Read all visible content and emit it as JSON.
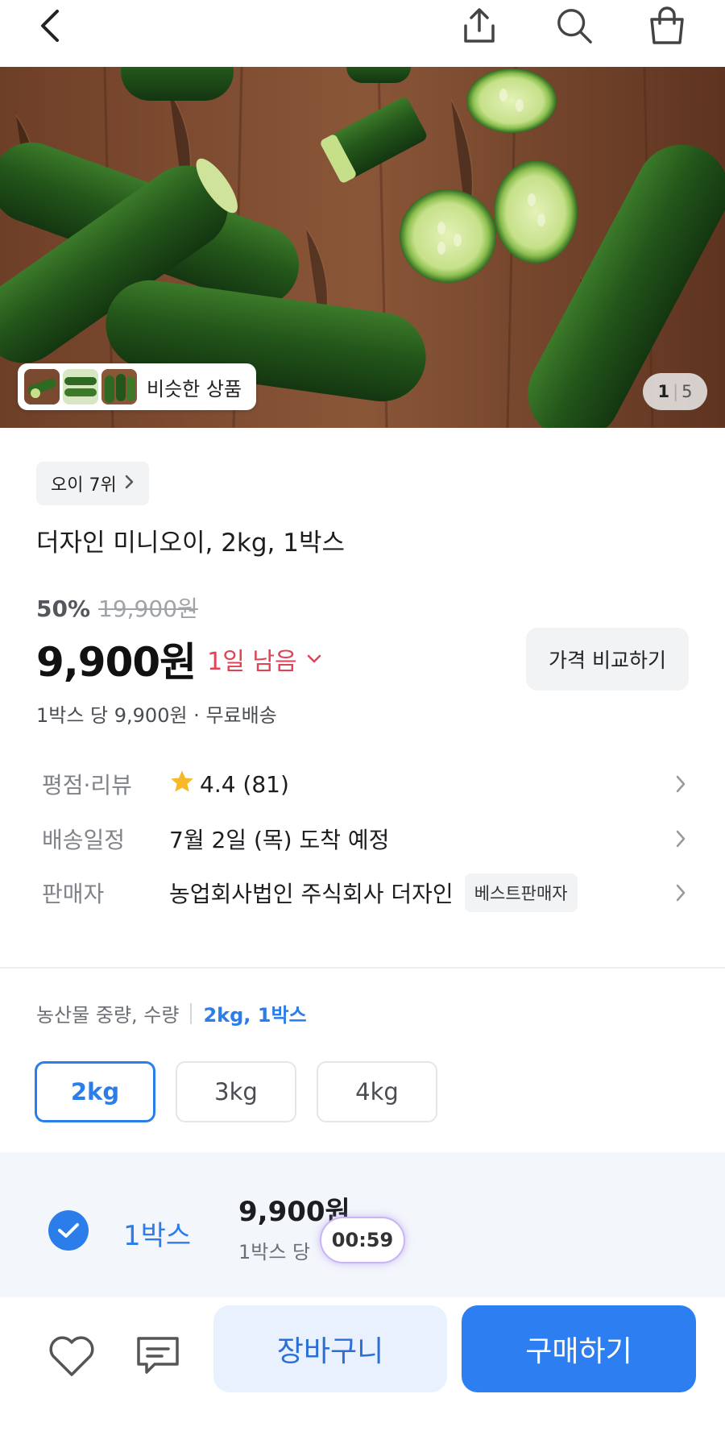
{
  "topbar": {
    "back_icon": "chevron-left-icon",
    "share_icon": "share-icon",
    "search_icon": "search-icon",
    "cart_icon": "shopping-bag-icon"
  },
  "hero": {
    "similar_label": "비슷한 상품",
    "page_current": "1",
    "page_total": "5"
  },
  "product": {
    "rank_chip": "오이 7위",
    "title": "더자인 미니오이, 2kg, 1박스",
    "discount": "50%",
    "original_price": "19,900원",
    "price": "9,900원",
    "time_left": "1일 남음",
    "compare_label": "가격 비교하기",
    "unit_note": "1박스 당 9,900원 · 무료배송"
  },
  "meta": {
    "rating_label": "평점·리뷰",
    "rating_value": "4.4 (81)",
    "delivery_label": "배송일정",
    "delivery_value": "7월 2일 (목) 도착 예정",
    "seller_label": "판매자",
    "seller_value": "농업회사법인 주식회사 더자인",
    "seller_badge": "베스트판매자"
  },
  "options": {
    "heading": "농산물 중량, 수량",
    "selected_summary": "2kg, 1박스",
    "choices": [
      "2kg",
      "3kg",
      "4kg"
    ],
    "active_index": 0
  },
  "selection": {
    "unit": "1박스",
    "price": "9,900원",
    "note": "1박스 당",
    "timer": "00:59"
  },
  "bottom": {
    "cart_label": "장바구니",
    "buy_label": "구매하기"
  },
  "colors": {
    "accent": "#2b7de9",
    "danger": "#e04355",
    "buy_button": "#2d7ef0",
    "cart_button_bg": "#e8f1fd"
  }
}
